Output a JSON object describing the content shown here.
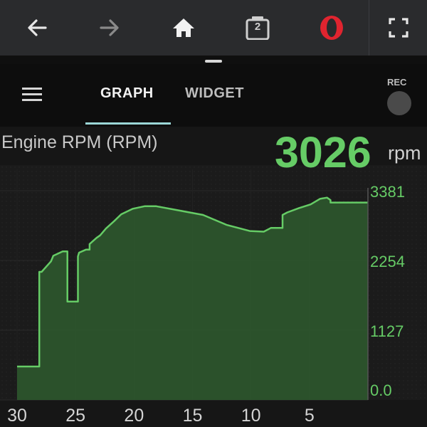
{
  "browser": {
    "tabs_count": "2",
    "icons": [
      "back-arrow-icon",
      "forward-arrow-icon",
      "home-icon",
      "tabs-icon",
      "opera-logo-icon",
      "fullscreen-icon"
    ],
    "accent": "#e0242f"
  },
  "app": {
    "tabs": [
      {
        "label": "GRAPH",
        "active": true
      },
      {
        "label": "WIDGET",
        "active": false
      }
    ],
    "rec_label": "REC"
  },
  "sensor": {
    "title": "Engine RPM (RPM)",
    "value": "3026",
    "unit": "rpm",
    "color": "#66cc66"
  },
  "chart_data": {
    "type": "area",
    "xlabel": "",
    "ylabel": "",
    "x_ticks": [
      "30",
      "25",
      "20",
      "15",
      "10",
      "5"
    ],
    "x_tick_values": [
      30,
      25,
      20,
      15,
      10,
      5
    ],
    "y_ticks": [
      "3381",
      "2254",
      "1127",
      "0.0"
    ],
    "y_tick_values": [
      3381,
      2254,
      1127,
      0
    ],
    "xlim": [
      30,
      0
    ],
    "ylim": [
      0,
      3381
    ],
    "grid": true,
    "series": [
      {
        "color": "#66cc66",
        "fill": "#2e5a2e",
        "x": [
          30.0,
          28.1,
          28.1,
          27.9,
          27.1,
          27.1,
          26.9,
          26.1,
          25.9,
          25.7,
          25.7,
          25.1,
          24.8,
          24.8,
          24.7,
          24.1,
          23.8,
          23.8,
          23.2,
          22.9,
          22.4,
          21.7,
          21.1,
          20.1,
          19.1,
          18.1,
          16.1,
          14.1,
          12.1,
          10.1,
          8.9,
          8.3,
          7.3,
          7.3,
          6.9,
          5.9,
          4.9,
          4.1,
          3.5,
          3.2,
          3.2,
          1.1,
          0.0
        ],
        "y": [
          540,
          540,
          2070,
          2070,
          2240,
          2240,
          2330,
          2400,
          2400,
          2400,
          1590,
          1590,
          1590,
          2320,
          2380,
          2430,
          2430,
          2520,
          2620,
          2660,
          2770,
          2890,
          3000,
          3090,
          3130,
          3130,
          3060,
          2990,
          2830,
          2730,
          2720,
          2780,
          2780,
          2990,
          3030,
          3100,
          3160,
          3250,
          3270,
          3230,
          3190,
          3190,
          3190
        ]
      }
    ]
  }
}
